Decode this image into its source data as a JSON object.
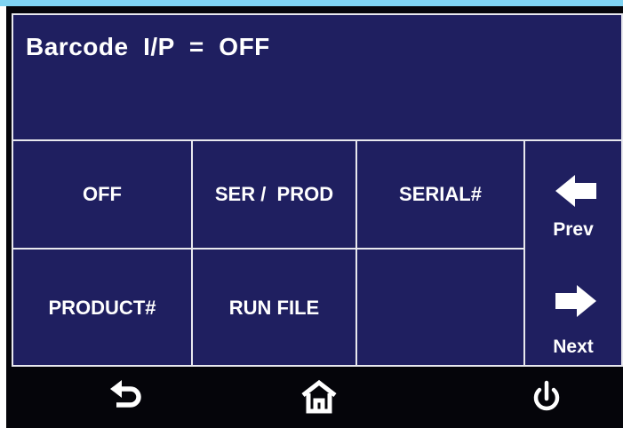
{
  "header": {
    "title": "Barcode  I/P  =  OFF"
  },
  "options": {
    "off": "OFF",
    "ser_prod": "SER /  PROD",
    "serial": "SERIAL#",
    "product": "PRODUCT#",
    "run_file": "RUN FILE",
    "empty": ""
  },
  "nav": {
    "prev_label": "Prev",
    "next_label": "Next"
  },
  "toolbar": {
    "back_icon": "back-arrow-icon",
    "home_icon": "home-icon",
    "power_icon": "power-icon"
  },
  "colors": {
    "panel_bg": "#1f1f60",
    "border": "#e8e8ee",
    "screen_bg": "#05050a",
    "top_strip": "#7fd3f2"
  }
}
